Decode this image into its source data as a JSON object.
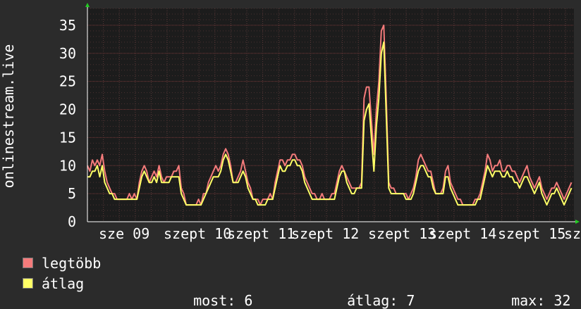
{
  "chart_data": {
    "type": "line",
    "ylabel": "onlinestream.live",
    "ylim": [
      0,
      38
    ],
    "yticks": [
      0,
      5,
      10,
      15,
      20,
      25,
      30,
      35
    ],
    "grid": true,
    "x_tick_labels": [
      "sze 09",
      "szept 10",
      "szept 11",
      "szept 12",
      "szept 13",
      "szept 14",
      "szept 15",
      "sz"
    ],
    "series": [
      {
        "name": "legtöbb",
        "color": "#f57b7b",
        "values": [
          10,
          9,
          11,
          10,
          11,
          10,
          12,
          9,
          7,
          6,
          5,
          5,
          4,
          4,
          4,
          4,
          4,
          5,
          4,
          5,
          4,
          7,
          9,
          10,
          9,
          7,
          8,
          9,
          8,
          10,
          8,
          7,
          8,
          8,
          8,
          9,
          9,
          10,
          6,
          5,
          3,
          3,
          3,
          3,
          3,
          4,
          3,
          5,
          5,
          7,
          8,
          9,
          10,
          9,
          10,
          12,
          13,
          12,
          10,
          7,
          7,
          8,
          9,
          11,
          9,
          7,
          6,
          4,
          4,
          4,
          3,
          4,
          4,
          4,
          5,
          4,
          7,
          9,
          11,
          11,
          10,
          11,
          11,
          12,
          12,
          11,
          11,
          10,
          8,
          7,
          6,
          5,
          5,
          4,
          4,
          5,
          4,
          4,
          4,
          5,
          5,
          7,
          9,
          10,
          9,
          8,
          7,
          6,
          6,
          6,
          6,
          7,
          22,
          24,
          24,
          18,
          12,
          20,
          25,
          34,
          35,
          22,
          7,
          6,
          6,
          5,
          5,
          5,
          5,
          5,
          4,
          5,
          6,
          8,
          11,
          12,
          11,
          10,
          9,
          9,
          7,
          5,
          5,
          5,
          6,
          9,
          10,
          7,
          6,
          5,
          4,
          4,
          3,
          3,
          3,
          3,
          3,
          4,
          4,
          5,
          7,
          9,
          12,
          11,
          9,
          10,
          10,
          11,
          9,
          9,
          10,
          10,
          9,
          9,
          8,
          7,
          8,
          9,
          10,
          8,
          7,
          6,
          7,
          8,
          6,
          5,
          4,
          5,
          6,
          6,
          7,
          6,
          5,
          4,
          5,
          6,
          7
        ]
      },
      {
        "name": "átlag",
        "color": "#ffff66",
        "values": [
          8,
          8,
          9,
          9,
          10,
          8,
          10,
          7,
          6,
          5,
          5,
          4,
          4,
          4,
          4,
          4,
          4,
          4,
          4,
          4,
          4,
          6,
          8,
          9,
          8,
          7,
          7,
          8,
          7,
          9,
          7,
          7,
          7,
          7,
          8,
          8,
          8,
          8,
          5,
          4,
          3,
          3,
          3,
          3,
          3,
          3,
          3,
          4,
          5,
          6,
          7,
          8,
          8,
          8,
          9,
          11,
          12,
          11,
          9,
          7,
          7,
          7,
          8,
          9,
          8,
          6,
          5,
          4,
          4,
          3,
          3,
          3,
          3,
          4,
          4,
          4,
          6,
          8,
          10,
          9,
          9,
          10,
          10,
          11,
          11,
          10,
          10,
          9,
          7,
          6,
          5,
          4,
          4,
          4,
          4,
          4,
          4,
          4,
          4,
          4,
          4,
          6,
          8,
          9,
          9,
          7,
          6,
          5,
          5,
          6,
          6,
          6,
          18,
          20,
          21,
          15,
          9,
          17,
          22,
          30,
          32,
          19,
          6,
          5,
          5,
          5,
          5,
          5,
          5,
          4,
          4,
          4,
          5,
          7,
          9,
          10,
          10,
          9,
          8,
          8,
          6,
          5,
          5,
          5,
          5,
          8,
          8,
          6,
          5,
          4,
          3,
          3,
          3,
          3,
          3,
          3,
          3,
          3,
          4,
          4,
          6,
          8,
          10,
          9,
          8,
          9,
          9,
          9,
          8,
          8,
          9,
          8,
          8,
          7,
          7,
          6,
          7,
          8,
          8,
          7,
          6,
          5,
          6,
          7,
          5,
          4,
          3,
          4,
          5,
          5,
          6,
          5,
          4,
          3,
          4,
          5,
          6
        ]
      }
    ]
  },
  "legend": [
    {
      "label": "legtöbb",
      "color": "#f57b7b"
    },
    {
      "label": "átlag",
      "color": "#ffff66"
    }
  ],
  "stats": [
    {
      "label": "most:",
      "value": "6"
    },
    {
      "label": "átlag:",
      "value": "7"
    },
    {
      "label": "max:",
      "value": "32"
    }
  ]
}
